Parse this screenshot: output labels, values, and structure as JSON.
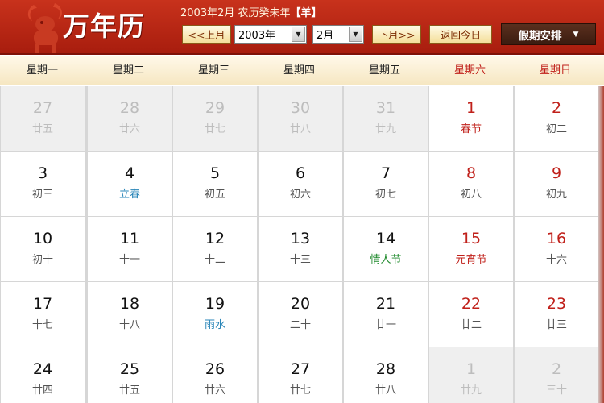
{
  "header": {
    "title": "万年历",
    "date_info": "2003年2月 农历癸未年",
    "zodiac": "【羊】"
  },
  "controls": {
    "prev_month": "<<上月",
    "year_value": "2003年",
    "month_value": "2月",
    "next_month": "下月>>",
    "today": "返回今日",
    "holiday": "假期安排",
    "holiday_arrow": "▼"
  },
  "weekdays": [
    "星期一",
    "星期二",
    "星期三",
    "星期四",
    "星期五",
    "星期六",
    "星期日"
  ],
  "days": [
    {
      "num": "27",
      "lunar": "廿五",
      "other": true
    },
    {
      "num": "28",
      "lunar": "廿六",
      "other": true
    },
    {
      "num": "29",
      "lunar": "廿七",
      "other": true
    },
    {
      "num": "30",
      "lunar": "廿八",
      "other": true
    },
    {
      "num": "31",
      "lunar": "廿九",
      "other": true
    },
    {
      "num": "1",
      "lunar": "春节",
      "style": "red"
    },
    {
      "num": "2",
      "lunar": "初二"
    },
    {
      "num": "3",
      "lunar": "初三"
    },
    {
      "num": "4",
      "lunar": "立春",
      "style": "blue"
    },
    {
      "num": "5",
      "lunar": "初五"
    },
    {
      "num": "6",
      "lunar": "初六"
    },
    {
      "num": "7",
      "lunar": "初七"
    },
    {
      "num": "8",
      "lunar": "初八"
    },
    {
      "num": "9",
      "lunar": "初九"
    },
    {
      "num": "10",
      "lunar": "初十"
    },
    {
      "num": "11",
      "lunar": "十一"
    },
    {
      "num": "12",
      "lunar": "十二"
    },
    {
      "num": "13",
      "lunar": "十三"
    },
    {
      "num": "14",
      "lunar": "情人节",
      "style": "green"
    },
    {
      "num": "15",
      "lunar": "元宵节",
      "style": "red"
    },
    {
      "num": "16",
      "lunar": "十六"
    },
    {
      "num": "17",
      "lunar": "十七"
    },
    {
      "num": "18",
      "lunar": "十八"
    },
    {
      "num": "19",
      "lunar": "雨水",
      "style": "blue"
    },
    {
      "num": "20",
      "lunar": "二十"
    },
    {
      "num": "21",
      "lunar": "廿一"
    },
    {
      "num": "22",
      "lunar": "廿二"
    },
    {
      "num": "23",
      "lunar": "廿三"
    },
    {
      "num": "24",
      "lunar": "廿四"
    },
    {
      "num": "25",
      "lunar": "廿五"
    },
    {
      "num": "26",
      "lunar": "廿六"
    },
    {
      "num": "27",
      "lunar": "廿七"
    },
    {
      "num": "28",
      "lunar": "廿八"
    },
    {
      "num": "1",
      "lunar": "廿九",
      "other": true
    },
    {
      "num": "2",
      "lunar": "三十",
      "other": true
    }
  ],
  "icons": {
    "logo": "goat-logo-icon"
  },
  "colors": {
    "header_red": "#b8281a",
    "weekend_red": "#c0201a",
    "solar_term_blue": "#2a86b8",
    "festival_green": "#1f8a2c"
  }
}
